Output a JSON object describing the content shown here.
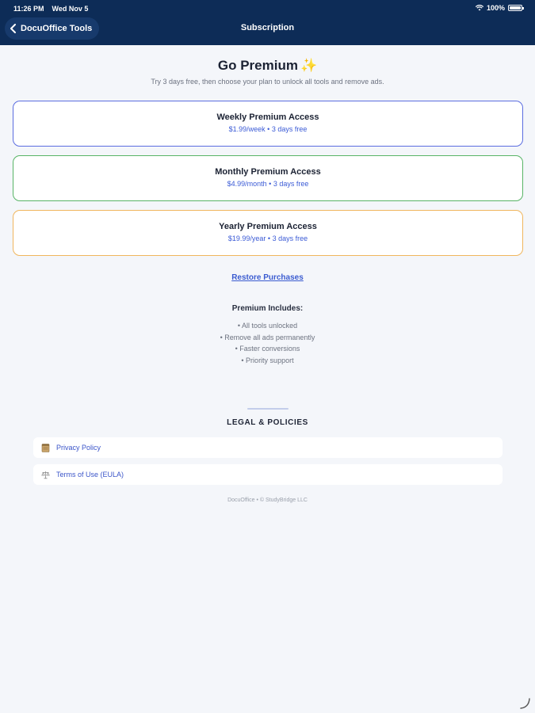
{
  "status": {
    "time": "11:26 PM",
    "date": "Wed Nov 5",
    "battery": "100%"
  },
  "nav": {
    "back_label": "DocuOffice Tools",
    "title": "Subscription"
  },
  "header": {
    "title": "Go Premium",
    "title_emoji": "✨",
    "subtitle": "Try 3 days free, then choose your plan to unlock all tools and remove ads."
  },
  "plans": [
    {
      "name": "Weekly Premium Access",
      "price": "$1.99/week • 3 days free",
      "color": "#5b6de0"
    },
    {
      "name": "Monthly Premium Access",
      "price": "$4.99/month • 3 days free",
      "color": "#58b466"
    },
    {
      "name": "Yearly Premium Access",
      "price": "$19.99/year • 3 days free",
      "color": "#f0b65d"
    }
  ],
  "restore_label": "Restore Purchases",
  "includes": {
    "title": "Premium Includes:",
    "items": [
      "• All tools unlocked",
      "• Remove all ads permanently",
      "• Faster conversions",
      "• Priority support"
    ]
  },
  "legal": {
    "title": "LEGAL & POLICIES",
    "items": [
      {
        "label": "Privacy Policy",
        "icon": "document-icon"
      },
      {
        "label": "Terms of Use (EULA)",
        "icon": "scale-icon"
      }
    ]
  },
  "footer": "DocuOffice • © StudyBridge LLC",
  "colors": {
    "nav_bg": "#0d2c57",
    "accent": "#3b5bd6",
    "background": "#f4f6fa"
  }
}
